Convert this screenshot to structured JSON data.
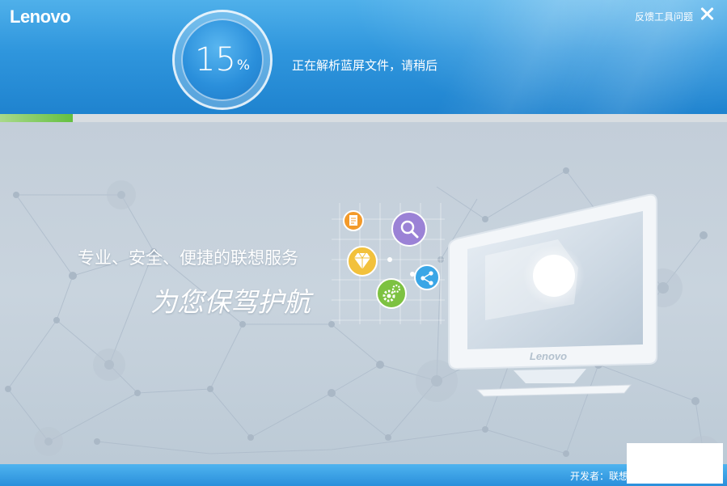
{
  "header": {
    "logo": "Lenovo",
    "feedback_label": "反馈工具问题",
    "progress_value": "15",
    "progress_unit": "%",
    "status_text": "正在解析蓝屏文件，请稍后"
  },
  "progress": {
    "percent": 15
  },
  "main": {
    "slogan_line1": "专业、安全、便捷的联想服务",
    "slogan_line2": "为您保驾护航",
    "monitor_brand": "Lenovo"
  },
  "footer": {
    "developer_label": "开发者：联想"
  },
  "icons": {
    "close": "close-icon",
    "document": "document-icon",
    "search": "search-icon",
    "diamond": "diamond-icon",
    "share": "share-icon",
    "gears": "gears-icon"
  },
  "colors": {
    "header_blue": "#2f96dd",
    "progress_green": "#64c040",
    "ring_border": "#ffffff",
    "doc_orange": "#f39a2a",
    "search_purple": "#9b82d6",
    "diamond_yellow": "#f2c13c",
    "share_blue": "#3aa6e6",
    "gear_green": "#7dc241"
  }
}
